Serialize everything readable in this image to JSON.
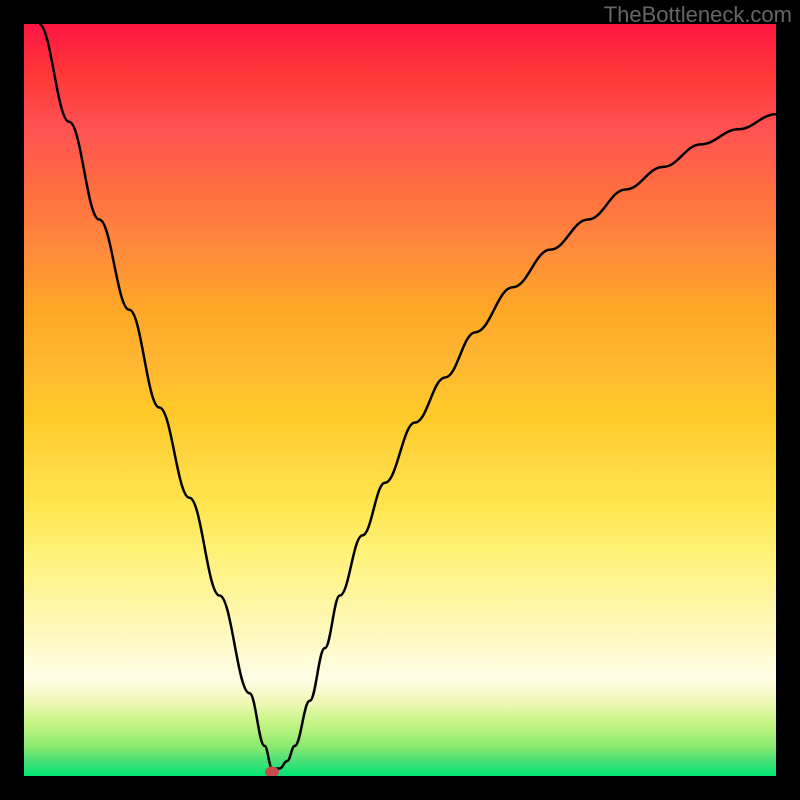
{
  "watermark": "TheBottleneck.com",
  "chart_data": {
    "type": "line",
    "title": "",
    "xlabel": "",
    "ylabel": "",
    "xlim": [
      0,
      100
    ],
    "ylim": [
      0,
      100
    ],
    "background_gradient": {
      "top": "#ff1744",
      "mid_upper": "#ffa726",
      "mid": "#fff176",
      "mid_lower": "#fffde7",
      "bottom": "#00e676"
    },
    "series": [
      {
        "name": "bottleneck-curve",
        "description": "V-shaped bottleneck curve with minimum near x=33",
        "x": [
          2,
          6,
          10,
          14,
          18,
          22,
          26,
          30,
          32,
          33,
          34,
          35,
          36,
          38,
          40,
          42,
          45,
          48,
          52,
          56,
          60,
          65,
          70,
          75,
          80,
          85,
          90,
          95,
          100
        ],
        "values": [
          100,
          87,
          74,
          62,
          49,
          37,
          24,
          11,
          4,
          1,
          1,
          2,
          4,
          10,
          17,
          24,
          32,
          39,
          47,
          53,
          59,
          65,
          70,
          74,
          78,
          81,
          84,
          86,
          88
        ]
      }
    ],
    "marker": {
      "name": "optimal-point",
      "x": 33,
      "y": 0.5,
      "color": "#c94a4a"
    }
  }
}
